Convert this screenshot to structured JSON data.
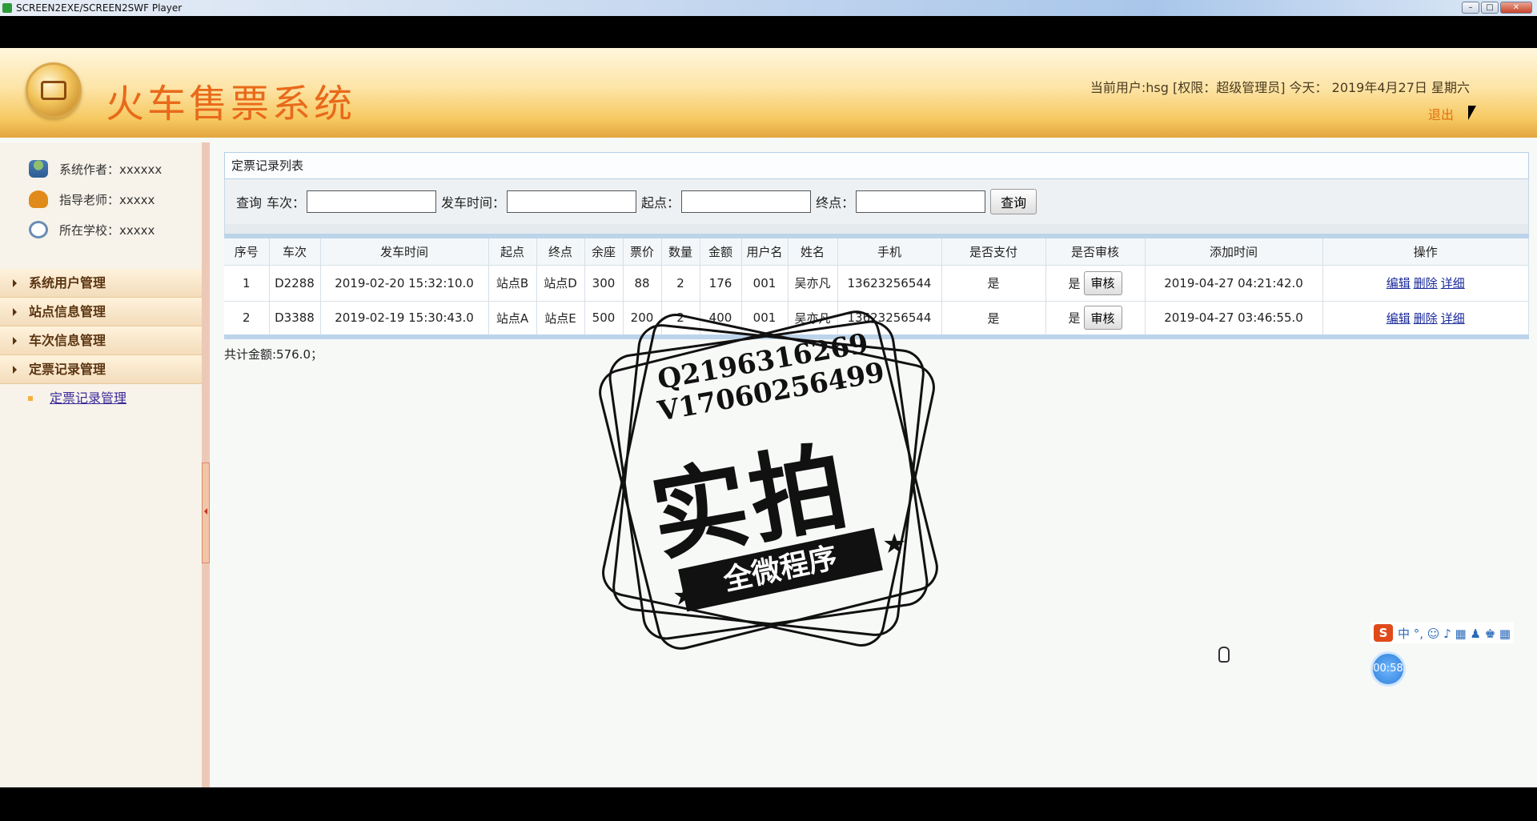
{
  "window": {
    "title": "SCREEN2EXE/SCREEN2SWF Player",
    "min": "–",
    "max": "□",
    "close": "✕"
  },
  "header": {
    "title": "火车售票系统",
    "user_info": "当前用户:hsg [权限：超级管理员] 今天： 2019年4月27日 星期六",
    "logout": "退出"
  },
  "sidebar": {
    "info": [
      {
        "label": "系统作者：xxxxxx",
        "icon": "user-group-icon"
      },
      {
        "label": "指导老师：xxxxx",
        "icon": "phone-icon"
      },
      {
        "label": "所在学校：xxxxx",
        "icon": "clock-icon"
      }
    ],
    "menu": [
      {
        "label": "系统用户管理"
      },
      {
        "label": "站点信息管理"
      },
      {
        "label": "车次信息管理"
      },
      {
        "label": "定票记录管理"
      }
    ],
    "sub_item": "定票记录管理"
  },
  "panel": {
    "title": "定票记录列表"
  },
  "search": {
    "prefix": "查询",
    "train_label": "车次：",
    "time_label": "发车时间：",
    "start_label": "起点：",
    "end_label": "终点：",
    "button": "查询"
  },
  "table": {
    "headers": [
      "序号",
      "车次",
      "发车时间",
      "起点",
      "终点",
      "余座",
      "票价",
      "数量",
      "金额",
      "用户名",
      "姓名",
      "手机",
      "是否支付",
      "是否审核",
      "添加时间",
      "操作"
    ],
    "rows": [
      {
        "no": "1",
        "train": "D2288",
        "depart": "2019-02-20 15:32:10.0",
        "start": "站点B",
        "end": "站点D",
        "seats": "300",
        "price": "88",
        "qty": "2",
        "amount": "176",
        "user": "001",
        "name": "吴亦凡",
        "phone": "13623256544",
        "paid": "是",
        "audited": "是",
        "audit_btn": "审核",
        "added": "2019-04-27 04:21:42.0"
      },
      {
        "no": "2",
        "train": "D3388",
        "depart": "2019-02-19 15:30:43.0",
        "start": "站点A",
        "end": "站点E",
        "seats": "500",
        "price": "200",
        "qty": "2",
        "amount": "400",
        "user": "001",
        "name": "吴亦凡",
        "phone": "13623256544",
        "paid": "是",
        "audited": "是",
        "audit_btn": "审核",
        "added": "2019-04-27 03:46:55.0"
      }
    ],
    "actions": {
      "edit": "编辑",
      "delete": "删除",
      "detail": "详细"
    }
  },
  "total": "共计金额:576.0；",
  "watermark": {
    "line1": "Q2196316269",
    "line2": "V17060256499",
    "big": "实拍",
    "ribbon": "全微程序"
  },
  "overlay": {
    "ime_logo": "S",
    "ime_items": "中 °, ☺ ♪ ▦ ♟ ♚ ▦",
    "timer": "00:58"
  }
}
